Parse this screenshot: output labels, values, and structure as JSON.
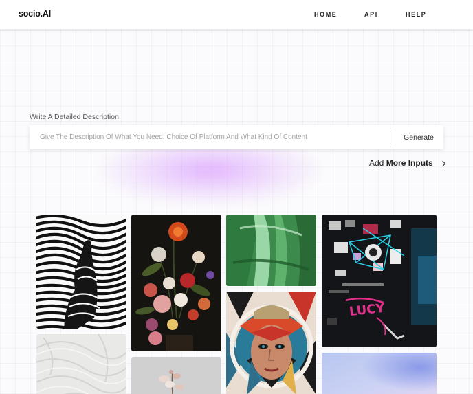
{
  "brand": {
    "logo": "socio.AI"
  },
  "nav": {
    "items": [
      "HOME",
      "API",
      "HELP"
    ]
  },
  "prompt": {
    "label": "Write A Detailed Description",
    "placeholder": "Give The Description Of What You Need, Choice Of Platform And What Kind Of Content",
    "value": "",
    "button": "Generate"
  },
  "add_more": {
    "prefix": "Add",
    "bold": "More Inputs"
  },
  "colors": {
    "accent_glow": "#ce80ff",
    "card_bg": "#ffffff"
  },
  "gallery": [
    {
      "name": "op-art-wave-figure-image"
    },
    {
      "name": "plaster-swirl-texture-image"
    },
    {
      "name": "still-life-flowers-painting-image"
    },
    {
      "name": "dried-flower-stem-image"
    },
    {
      "name": "green-abstract-brushstroke-image"
    },
    {
      "name": "geometric-face-portrait-image"
    },
    {
      "name": "graffiti-wall-collage-image"
    },
    {
      "name": "blue-lilac-gradient-image"
    }
  ],
  "icons": {
    "add_more_arrow": "chevron-right-icon"
  }
}
